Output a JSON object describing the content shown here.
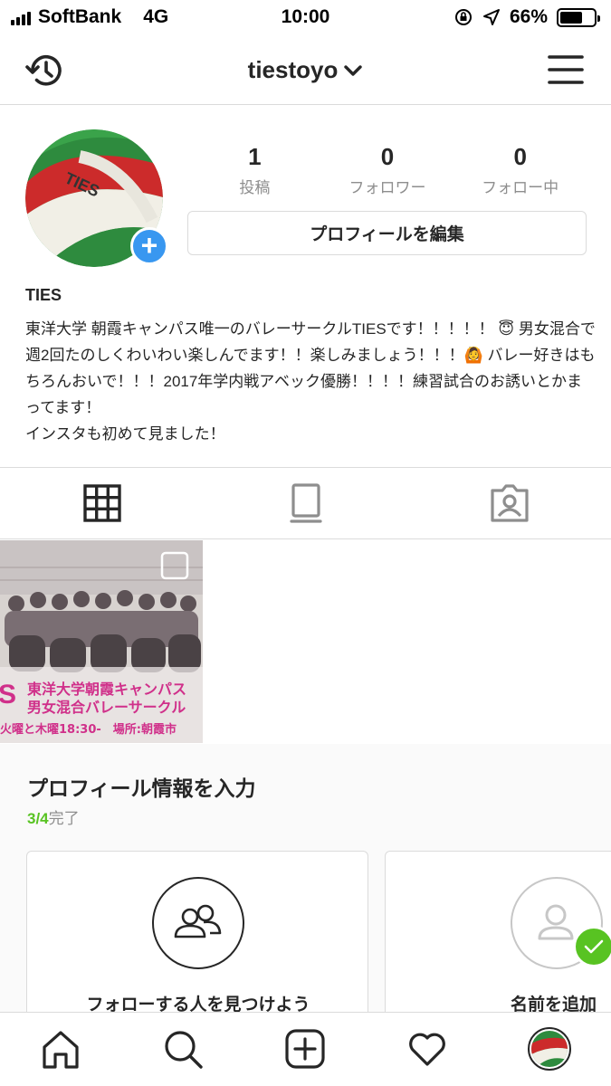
{
  "status_bar": {
    "carrier": "SoftBank",
    "network": "4G",
    "time": "10:00",
    "battery_percent": "66%",
    "battery_level": 0.66,
    "icons": [
      "signal-icon",
      "orientation-lock-icon",
      "location-icon",
      "battery-icon"
    ]
  },
  "nav": {
    "username": "tiestoyo",
    "icons": [
      "history-icon",
      "chevron-down-icon",
      "menu-icon"
    ]
  },
  "profile": {
    "stats": [
      {
        "value": "1",
        "label": "投稿"
      },
      {
        "value": "0",
        "label": "フォロワー"
      },
      {
        "value": "0",
        "label": "フォロー中"
      }
    ],
    "edit_button": "プロフィールを編集",
    "add_badge": "+",
    "avatar_text": "TIES",
    "name": "TIES",
    "bio": "東洋大学 朝霞キャンパス唯一のバレーサークルTIESです！！！！！ 😇 男女混合で週2回たのしくわいわい楽しんでます！！楽しみましょう！！！🙆 バレー好きはもちろんおいで！！！2017年学内戦アベック優勝！！！！練習試合のお誘いとかまってます！\nインスタも初めて見ました！"
  },
  "tabs": [
    {
      "icon": "grid-icon",
      "active": true
    },
    {
      "icon": "igtv-icon",
      "active": false
    },
    {
      "icon": "tagged-icon",
      "active": false
    }
  ],
  "post": {
    "caption_line1": "東洋大学朝霞キャンパス",
    "caption_line2": "男女混合バレーサークル",
    "caption_line3": "火曜と木曜18:30-　場所:朝霞市",
    "left_letter": "S"
  },
  "complete_profile": {
    "title": "プロフィール情報を入力",
    "progress_done": "3/4",
    "progress_suffix": "完了",
    "cards": [
      {
        "label": "フォローする人を見つけよう",
        "icon": "people-icon",
        "completed": false
      },
      {
        "label": "名前を追加",
        "icon": "person-icon",
        "completed": true
      }
    ]
  },
  "bottom_nav": {
    "items": [
      "home-icon",
      "search-icon",
      "add-post-icon",
      "heart-icon",
      "profile-avatar"
    ]
  },
  "colors": {
    "accent_blue": "#3897f0",
    "complete_green": "#58c322",
    "border": "#dbdbdb",
    "secondary_text": "#8e8e8e"
  }
}
